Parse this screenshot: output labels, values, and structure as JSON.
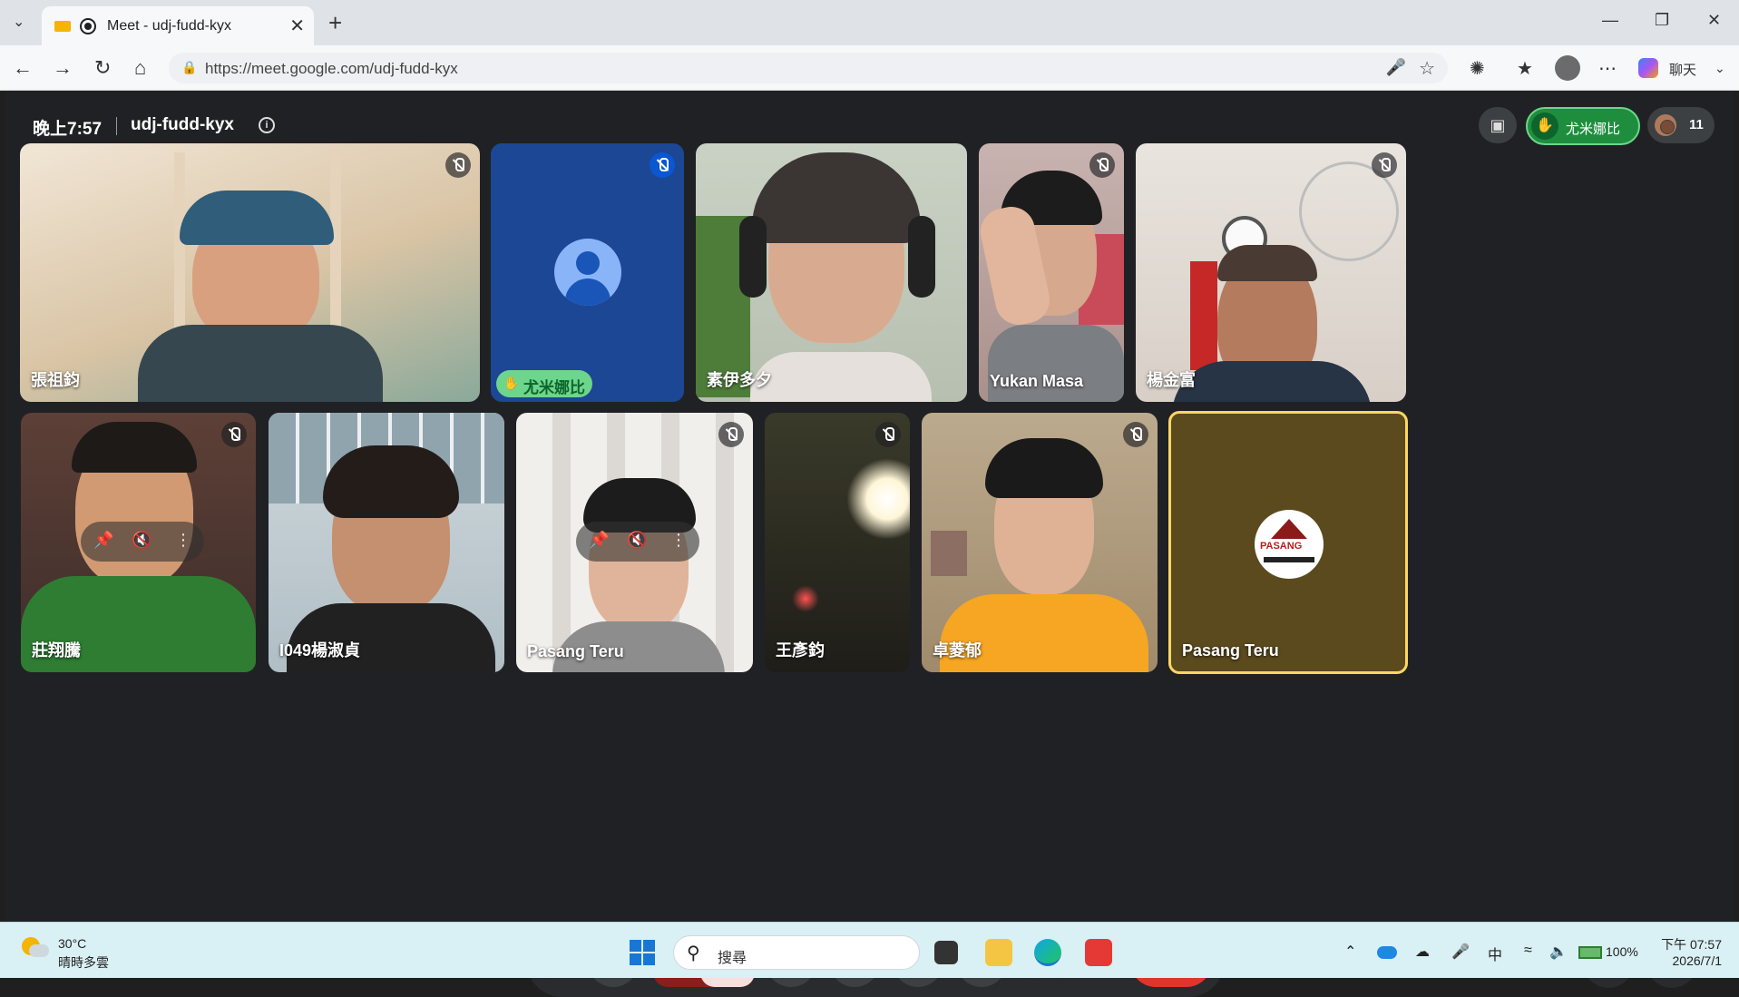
{
  "browser": {
    "tab_title": "Meet - udj-fudd-kyx",
    "close_glyph": "✕",
    "new_tab_glyph": "+",
    "url": "https://meet.google.com/udj-fudd-kyx",
    "chat_label": "聊天"
  },
  "meet": {
    "clock": "晚上7:57",
    "room_code": "udj-fudd-kyx",
    "raised_hand_name": "尤米娜比",
    "participant_count": "11",
    "accent_red": "#dc362e",
    "accent_green": "#1e8e3e"
  },
  "tiles": [
    {
      "name": "張祖鈞",
      "muted": true
    },
    {
      "name": "尤米娜比",
      "muted": true,
      "hand_raised": true
    },
    {
      "name": "素伊多夕",
      "muted": false
    },
    {
      "name": "Yukan Masa",
      "muted": true
    },
    {
      "name": "楊金富",
      "muted": true
    },
    {
      "name": "莊翔騰",
      "muted": true
    },
    {
      "name": "I049楊淑貞",
      "muted": false
    },
    {
      "name": "Pasang Teru",
      "muted": true
    },
    {
      "name": "王彥鈞",
      "muted": true
    },
    {
      "name": "卓菱郁",
      "muted": true
    },
    {
      "name": "Pasang Teru",
      "muted": false,
      "speaking": true,
      "avatar_text": "PASANG"
    }
  ],
  "taskbar": {
    "temperature": "30°C",
    "weather": "晴時多雲",
    "search_placeholder": "搜尋",
    "battery": "100%",
    "ime": "中",
    "time": "下午 07:57",
    "date": "2026/7/1"
  }
}
